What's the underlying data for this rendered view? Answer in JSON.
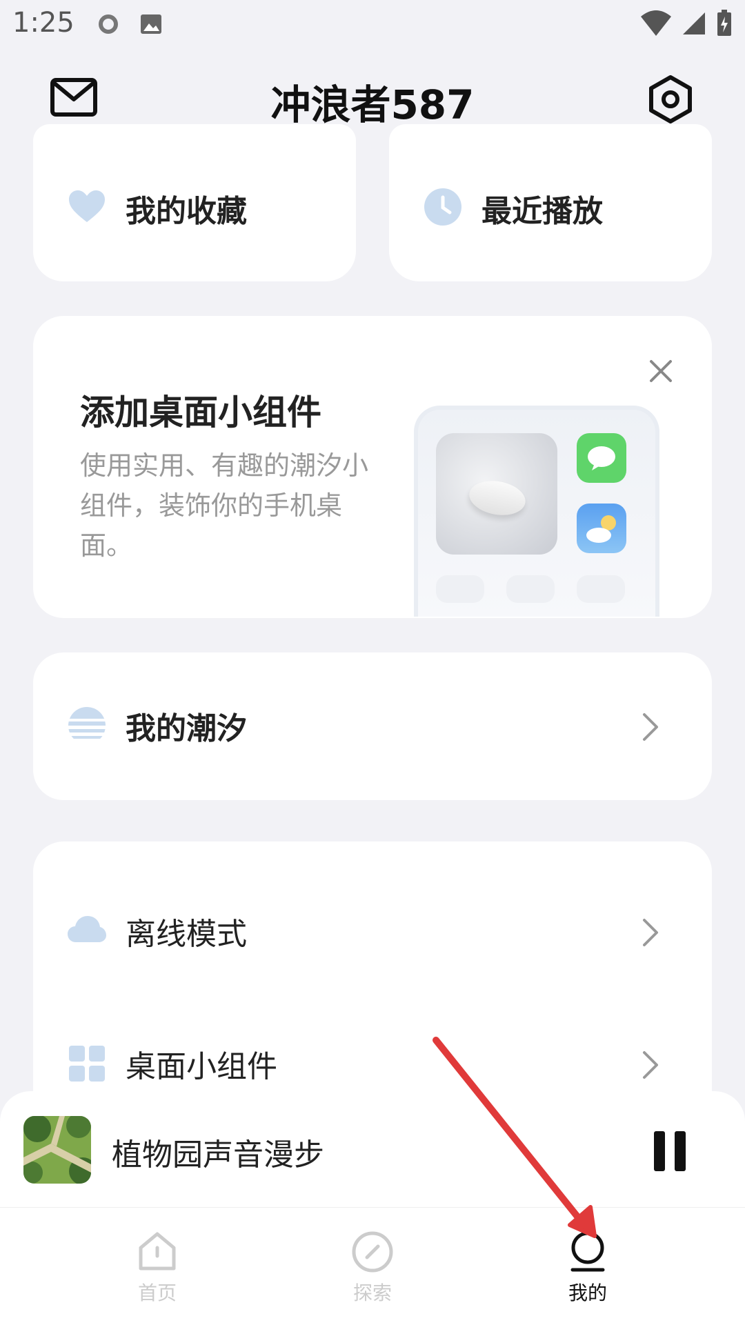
{
  "status_bar": {
    "time": "1:25"
  },
  "header": {
    "title": "冲浪者587"
  },
  "quick": {
    "favorites_label": "我的收藏",
    "recent_label": "最近播放"
  },
  "widget_card": {
    "title": "添加桌面小组件",
    "description": "使用实用、有趣的潮汐小组件，装饰你的手机桌面。"
  },
  "my_tide": {
    "label": "我的潮汐"
  },
  "settings_list": {
    "offline_label": "离线模式",
    "widgets_label": "桌面小组件"
  },
  "player": {
    "title": "植物园声音漫步"
  },
  "nav": {
    "home": "首页",
    "explore": "探索",
    "mine": "我的"
  },
  "colors": {
    "accent_red": "#e03a3a",
    "icon_blue": "#c9dbef",
    "nav_inactive": "#cccccc",
    "nav_active": "#111111"
  }
}
